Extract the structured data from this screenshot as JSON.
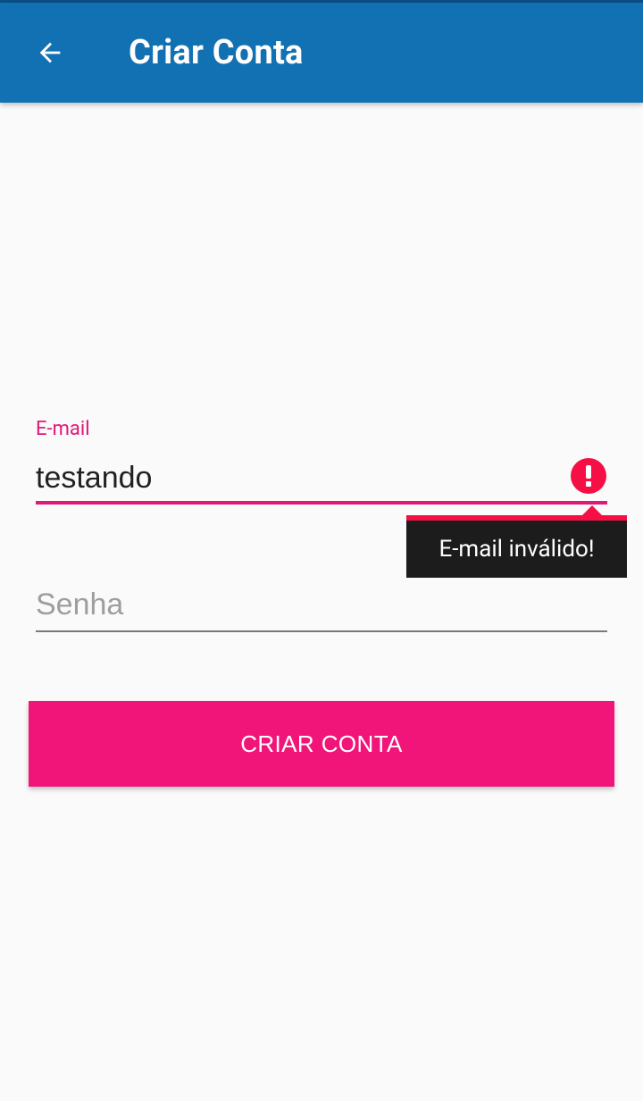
{
  "appbar": {
    "title": "Criar Conta",
    "back_icon": "arrow-back-icon",
    "color": "#1271b2"
  },
  "form": {
    "email": {
      "label": "E-mail",
      "value": "testando",
      "error_icon": "error-exclamation-icon",
      "error_message": "E-mail inválido!"
    },
    "password": {
      "placeholder": "Senha",
      "value": ""
    },
    "submit_label": "CRIAR CONTA"
  },
  "colors": {
    "accent": "#f1157a",
    "error": "#f50f45",
    "background": "#fafafa"
  }
}
